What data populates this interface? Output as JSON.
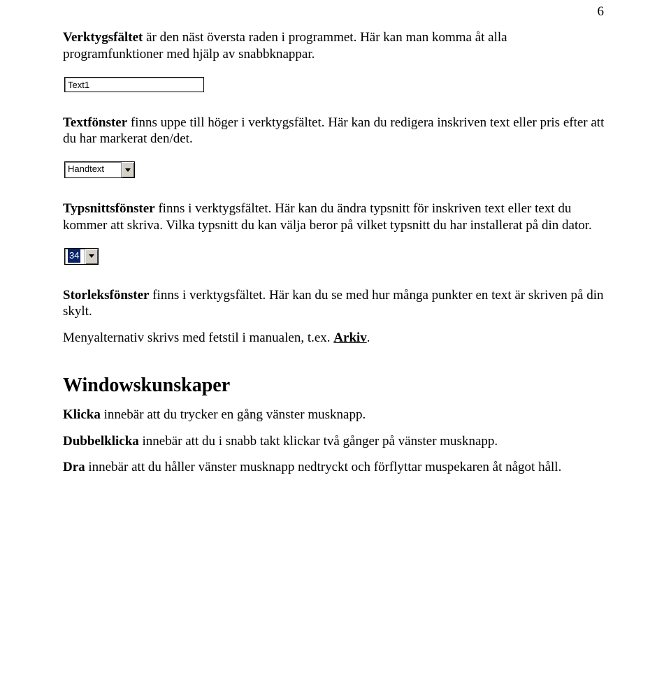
{
  "page_number": "6",
  "p1": {
    "b": "Verktygsfältet",
    "rest": " är den näst översta raden i programmet. Här kan man komma åt alla programfunktioner med hjälp av snabbknappar."
  },
  "textfield_value": "Text1",
  "p2": {
    "b": "Textfönster",
    "rest": " finns uppe till höger i verktygsfältet. Här kan du redigera inskriven text eller pris efter att du har markerat den/det."
  },
  "font_combo_value": "Handtext",
  "p3": {
    "b": "Typsnittsfönster",
    "rest": " finns i verktygsfältet. Här kan du ändra typsnitt för inskriven text eller text du kommer att skriva. Vilka typsnitt du kan välja beror på vilket typsnitt du har installerat på din dator."
  },
  "size_combo_value": "34",
  "p4": {
    "b": "Storleksfönster",
    "rest": " finns i verktygsfältet. Här kan du se med hur många punkter en text är skriven på din skylt."
  },
  "p5": {
    "pre": "Menyalternativ skrivs med fetstil i manualen, t.ex. ",
    "bold_underline": "Arkiv",
    "post": "."
  },
  "h_windows": "Windowskunskaper",
  "p6": {
    "b": "Klicka",
    "rest": " innebär att du trycker en gång vänster musknapp."
  },
  "p7": {
    "b": "Dubbelklicka",
    "rest": " innebär att du i snabb takt klickar två gånger på vänster musknapp."
  },
  "p8": {
    "b": "Dra",
    "rest": " innebär att du håller vänster musknapp nedtryckt och förflyttar muspekaren åt något håll."
  }
}
